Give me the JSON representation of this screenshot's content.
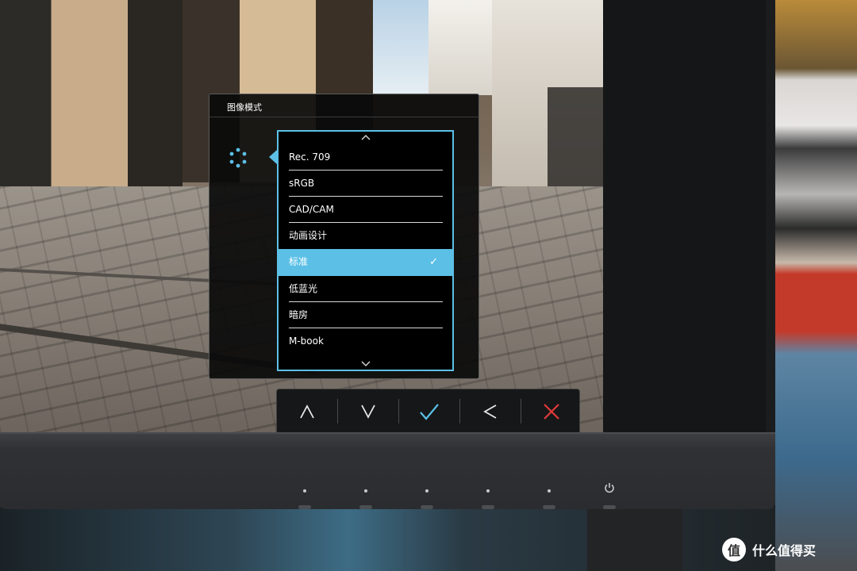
{
  "osd": {
    "title": "图像模式",
    "icon": "picture-mode-icon",
    "list": {
      "items": [
        {
          "label": "Rec. 709",
          "selected": false
        },
        {
          "label": "sRGB",
          "selected": false
        },
        {
          "label": "CAD/CAM",
          "selected": false
        },
        {
          "label": "动画设计",
          "selected": false
        },
        {
          "label": "标准",
          "selected": true
        },
        {
          "label": "低蓝光",
          "selected": false
        },
        {
          "label": "暗房",
          "selected": false
        },
        {
          "label": "M-book",
          "selected": false
        }
      ],
      "scroll_up_icon": "chevron-up-icon",
      "scroll_down_icon": "chevron-down-icon",
      "selected_mark": "✓"
    }
  },
  "controls": [
    {
      "name": "up-button",
      "icon": "chevron-up-icon"
    },
    {
      "name": "down-button",
      "icon": "chevron-down-icon"
    },
    {
      "name": "confirm-button",
      "icon": "check-icon"
    },
    {
      "name": "back-button",
      "icon": "chevron-left-icon"
    },
    {
      "name": "exit-button",
      "icon": "close-icon"
    }
  ],
  "colors": {
    "accent": "#5cc0e6",
    "exit": "#e23a3a",
    "osd_bg": "#0a0a0a"
  },
  "watermark": {
    "badge": "值",
    "text": "什么值得买"
  }
}
